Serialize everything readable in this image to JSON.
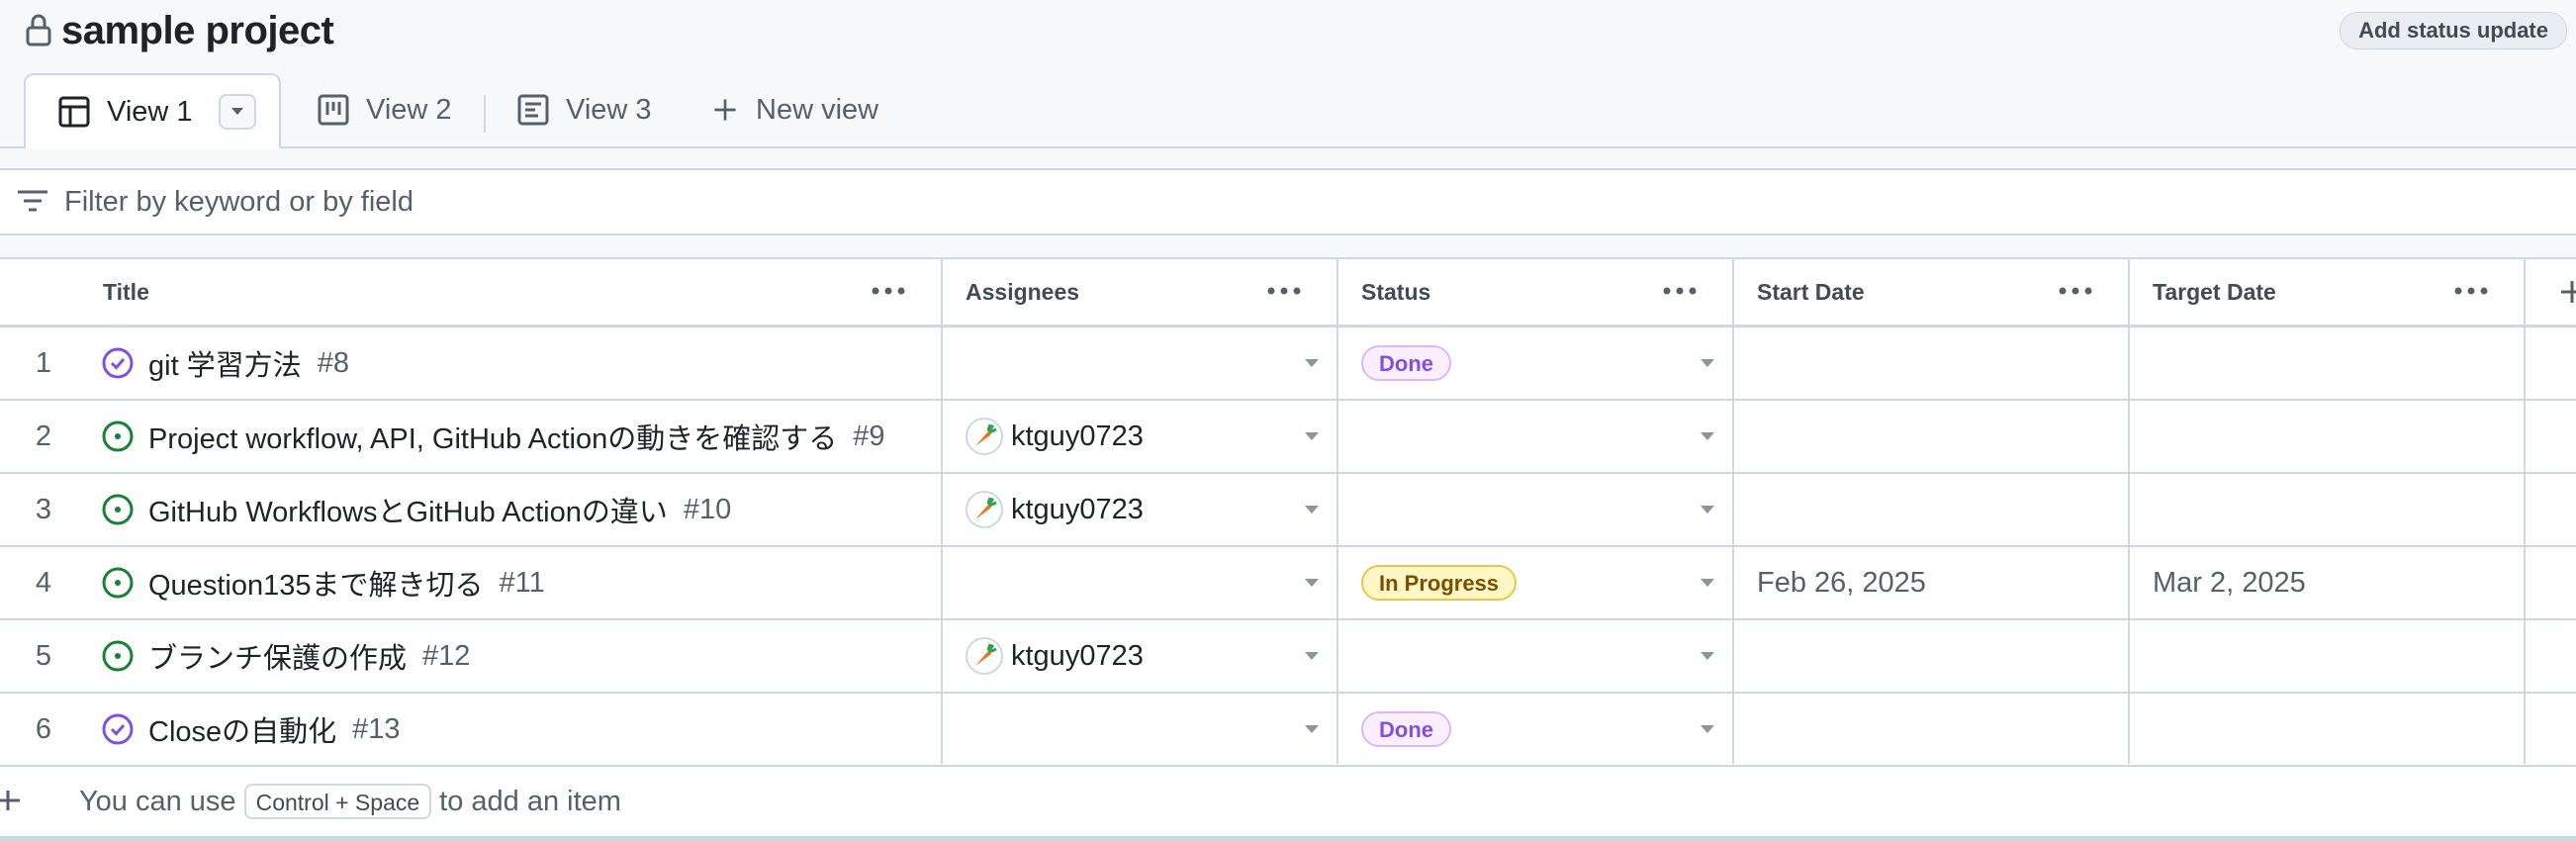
{
  "header": {
    "project_title": "sample project",
    "status_button": "Add status update"
  },
  "tabs": [
    {
      "label": "View 1",
      "icon": "table-icon",
      "active": true
    },
    {
      "label": "View 2",
      "icon": "board-icon",
      "active": false
    },
    {
      "label": "View 3",
      "icon": "roadmap-icon",
      "active": false
    }
  ],
  "new_view_label": "New view",
  "filter": {
    "placeholder": "Filter by keyword or by field"
  },
  "table": {
    "columns": [
      "Title",
      "Assignees",
      "Status",
      "Start Date",
      "Target Date"
    ],
    "rows": [
      {
        "num": "1",
        "state": "closed",
        "title": "git 学習方法",
        "issue": "#8",
        "assignee": "",
        "status": "Done",
        "start": "",
        "target": ""
      },
      {
        "num": "2",
        "state": "open",
        "title": "Project workflow, API, GitHub Actionの動きを確認する",
        "issue": "#9",
        "assignee": "ktguy0723",
        "status": "",
        "start": "",
        "target": ""
      },
      {
        "num": "3",
        "state": "open",
        "title": "GitHub WorkflowsとGitHub Actionの違い",
        "issue": "#10",
        "assignee": "ktguy0723",
        "status": "",
        "start": "",
        "target": ""
      },
      {
        "num": "4",
        "state": "open",
        "title": "Question135まで解き切る",
        "issue": "#11",
        "assignee": "",
        "status": "In Progress",
        "start": "Feb 26, 2025",
        "target": "Mar 2, 2025"
      },
      {
        "num": "5",
        "state": "open",
        "title": "ブランチ保護の作成",
        "issue": "#12",
        "assignee": "ktguy0723",
        "status": "",
        "start": "",
        "target": ""
      },
      {
        "num": "6",
        "state": "closed",
        "title": "Closeの自動化",
        "issue": "#13",
        "assignee": "",
        "status": "Done",
        "start": "",
        "target": ""
      }
    ],
    "add_hint": {
      "prefix": "You can use",
      "shortcut": "Control + Space",
      "suffix": "to add an item"
    }
  },
  "colors": {
    "open": "#1a7f37",
    "closed": "#8250df",
    "border": "#d0d7de"
  }
}
